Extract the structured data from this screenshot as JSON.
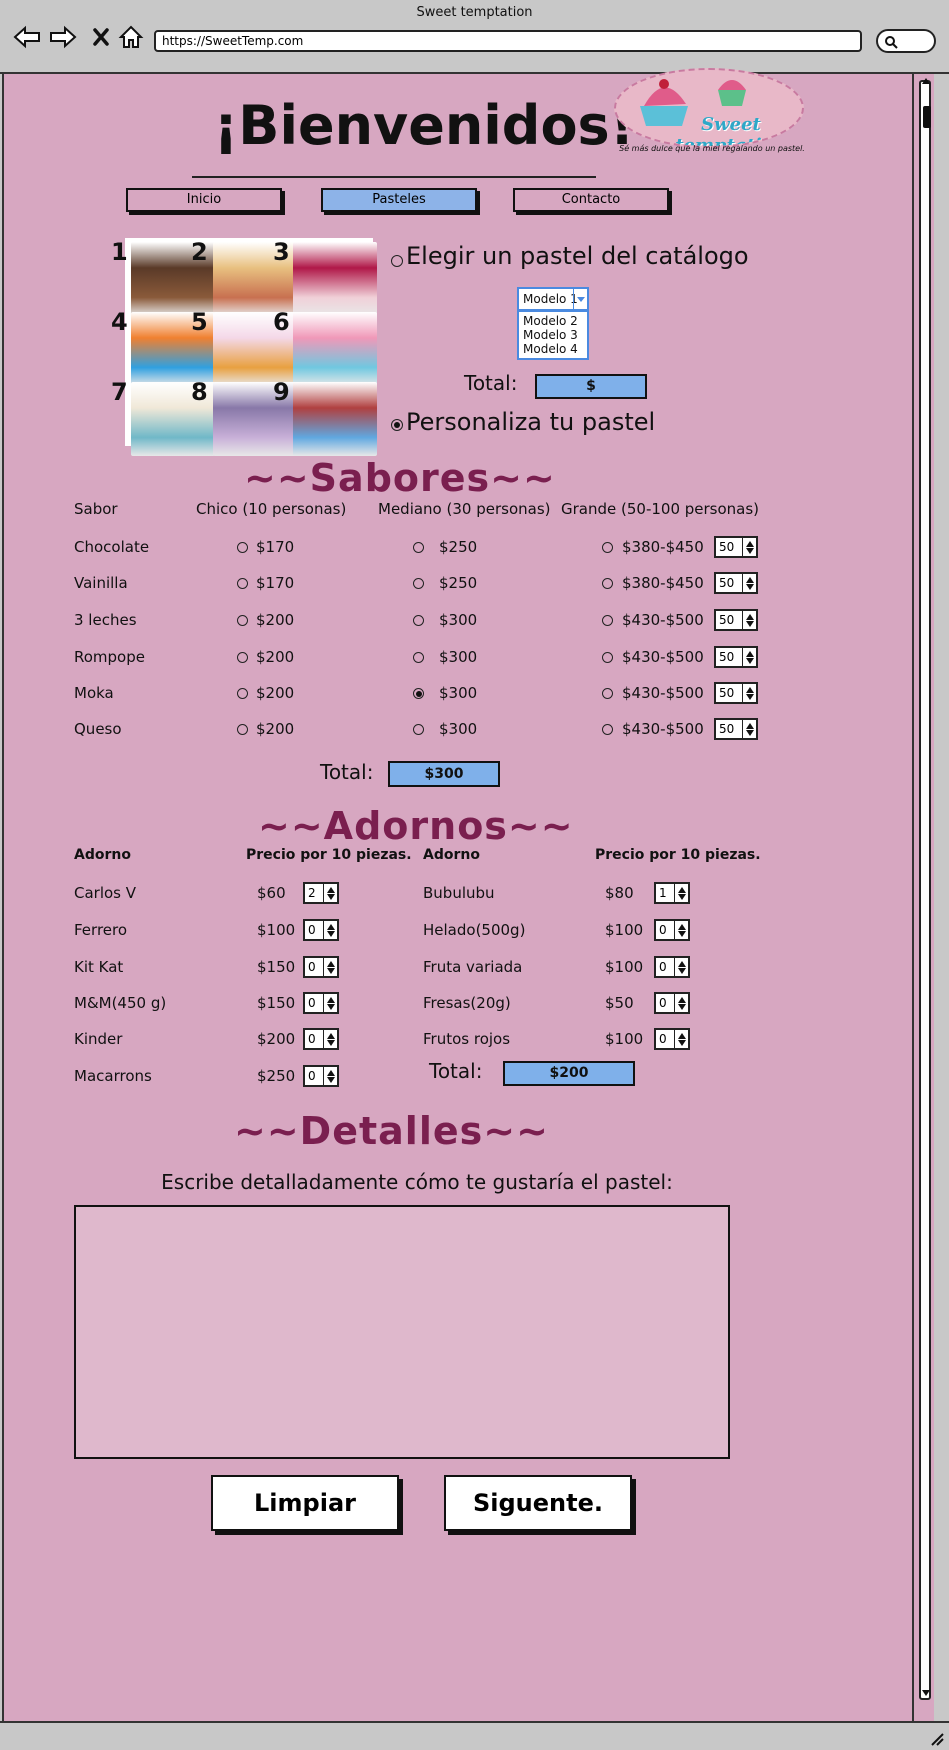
{
  "window": {
    "title": "Sweet temptation",
    "url": "https://SweetTemp.com"
  },
  "header": {
    "title": "¡Bienvenidos!",
    "logo_text": "Sweet temptation",
    "tagline": "Sé más dulce que la miel regalando un pastel."
  },
  "nav": {
    "inicio": "Inicio",
    "pasteles": "Pasteles",
    "contacto": "Contacto"
  },
  "catalog": {
    "numbers": [
      "1",
      "2",
      "3",
      "4",
      "5",
      "6",
      "7",
      "8",
      "9"
    ],
    "choose_label": "Elegir un pastel del catálogo",
    "select_value": "Modelo 1",
    "options": [
      "Modelo 2",
      "Modelo 3",
      "Modelo 4"
    ],
    "total_label": "Total:",
    "total_value": "$",
    "custom_label": "Personaliza tu pastel",
    "choose_selected": false,
    "custom_selected": true
  },
  "flavors": {
    "title": "~~Sabores~~",
    "headers": [
      "Sabor",
      "Chico (10 personas)",
      "Mediano (30 personas)",
      "Grande (50-100 personas)"
    ],
    "rows": [
      {
        "name": "Chocolate",
        "small": "$170",
        "medium": "$250",
        "large": "$380-$450",
        "qty": "50",
        "selected": ""
      },
      {
        "name": "Vainilla",
        "small": "$170",
        "medium": "$250",
        "large": "$380-$450",
        "qty": "50",
        "selected": ""
      },
      {
        "name": "3 leches",
        "small": "$200",
        "medium": "$300",
        "large": "$430-$500",
        "qty": "50",
        "selected": ""
      },
      {
        "name": "Rompope",
        "small": "$200",
        "medium": "$300",
        "large": "$430-$500",
        "qty": "50",
        "selected": ""
      },
      {
        "name": "Moka",
        "small": "$200",
        "medium": "$300",
        "large": "$430-$500",
        "qty": "50",
        "selected": "medium"
      },
      {
        "name": "Queso",
        "small": "$200",
        "medium": "$300",
        "large": "$430-$500",
        "qty": "50",
        "selected": ""
      }
    ],
    "total_label": "Total:",
    "total_value": "$300"
  },
  "decorations": {
    "title": "~~Adornos~~",
    "headers": [
      "Adorno",
      "Precio por 10 piezas.",
      "Adorno",
      "Precio por 10 piezas."
    ],
    "left": [
      {
        "name": "Carlos V",
        "price": "$60",
        "qty": "2"
      },
      {
        "name": "Ferrero",
        "price": "$100",
        "qty": "0"
      },
      {
        "name": "Kit Kat",
        "price": "$150",
        "qty": "0"
      },
      {
        "name": "M&M(450 g)",
        "price": "$150",
        "qty": "0"
      },
      {
        "name": "Kinder",
        "price": "$200",
        "qty": "0"
      },
      {
        "name": "Macarrons",
        "price": "$250",
        "qty": "0"
      }
    ],
    "right": [
      {
        "name": "Bubulubu",
        "price": "$80",
        "qty": "1"
      },
      {
        "name": "Helado(500g)",
        "price": "$100",
        "qty": "0"
      },
      {
        "name": "Fruta variada",
        "price": "$100",
        "qty": "0"
      },
      {
        "name": "Fresas(20g)",
        "price": "$50",
        "qty": "0"
      },
      {
        "name": "Frutos rojos",
        "price": "$100",
        "qty": "0"
      }
    ],
    "total_label": "Total:",
    "total_value": "$200"
  },
  "details": {
    "title": "~~Detalles~~",
    "prompt": "Escribe detalladamente cómo te gustaría el pastel:",
    "text": ""
  },
  "actions": {
    "clear": "Limpiar",
    "next": "Siguente."
  },
  "colors": {
    "page_bg": "#d7a7c1",
    "accent_blue": "#7fb0ea",
    "section_title": "#7a1f4f"
  }
}
